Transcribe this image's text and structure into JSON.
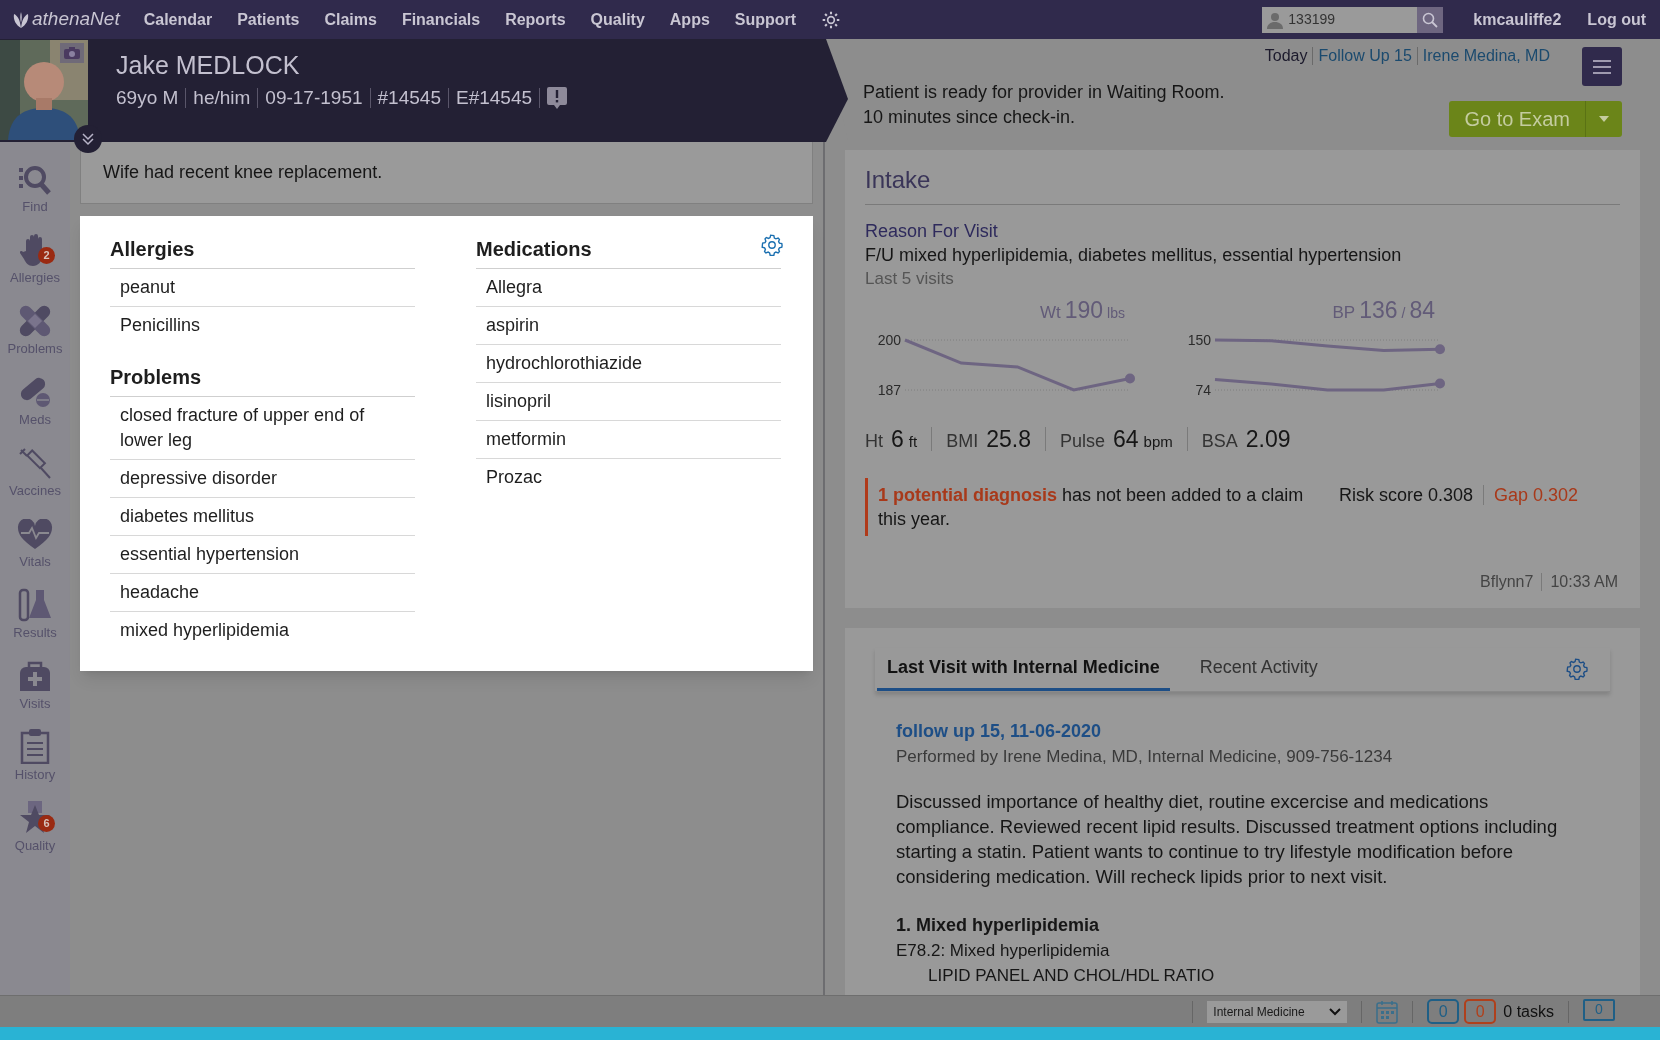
{
  "top_nav": {
    "logo": "athenaNet",
    "menu": [
      "Calendar",
      "Patients",
      "Claims",
      "Financials",
      "Reports",
      "Quality",
      "Apps",
      "Support"
    ],
    "search": {
      "value": "133199"
    },
    "user": "kmcauliffe2",
    "logout": "Log out"
  },
  "patient": {
    "photo": {
      "kind": "picture"
    },
    "name": "Jake MEDLOCK",
    "details": [
      "69yo M",
      "he/him",
      "09-17-1951",
      "#14545",
      "E#14545"
    ]
  },
  "visit_status": {
    "context": [
      {
        "text": "Today",
        "kind": "plain"
      },
      {
        "text": "Follow Up 15",
        "kind": "link"
      },
      {
        "text": "Irene Medina, MD",
        "kind": "link"
      }
    ],
    "message": [
      "Patient is ready for provider in Waiting Room.",
      "10 minutes since check-in."
    ],
    "primary_button": "Go to Exam"
  },
  "sidebar": {
    "items": [
      {
        "label": "Find"
      },
      {
        "label": "Allergies",
        "badge": "2"
      },
      {
        "label": "Problems"
      },
      {
        "label": "Meds"
      },
      {
        "label": "Vaccines"
      },
      {
        "label": "Vitals"
      },
      {
        "label": "Results"
      },
      {
        "label": "Visits"
      },
      {
        "label": "History"
      },
      {
        "label": "Quality",
        "badge": "6"
      }
    ]
  },
  "patient_note": "Wife had recent knee replacement.",
  "clinical_summary": {
    "sections": [
      {
        "title": "Allergies",
        "items": [
          "peanut",
          "Penicillins"
        ]
      },
      {
        "title": "Problems",
        "items": [
          "closed fracture of upper end of lower leg",
          "depressive disorder",
          "diabetes mellitus",
          "essential hypertension",
          "headache",
          "mixed hyperlipidemia"
        ]
      },
      {
        "title": "Medications",
        "items": [
          "Allegra",
          "aspirin",
          "hydrochlorothiazide",
          "lisinopril",
          "metformin",
          "Prozac"
        ]
      }
    ]
  },
  "intake": {
    "title": "Intake",
    "reason_label": "Reason For Visit",
    "reason": "F/U mixed hyperlipidemia, diabetes mellitus, essential hypertension",
    "history_label": "Last 5 visits",
    "charts": [
      {
        "reading": [
          {
            "text": "Wt",
            "kind": "label"
          },
          {
            "text": "190",
            "kind": "value"
          },
          {
            "text": "lbs",
            "kind": "unit"
          }
        ],
        "chart_data": {
          "type": "line",
          "ylim": [
            187,
            200
          ],
          "yticks": [
            187,
            200
          ],
          "series": [
            {
              "color": "#6e6582",
              "values": [
                200,
                194,
                193,
                187,
                190
              ]
            }
          ]
        }
      },
      {
        "reading": [
          {
            "text": "BP",
            "kind": "label"
          },
          {
            "text": "136",
            "kind": "value"
          },
          {
            "text": "/",
            "kind": "unit"
          },
          {
            "text": "84",
            "kind": "value"
          }
        ],
        "chart_data": {
          "type": "line",
          "ylim": [
            74,
            150
          ],
          "yticks": [
            74,
            150
          ],
          "series": [
            {
              "color": "#6e6582",
              "values": [
                150,
                149,
                141,
                134,
                136
              ]
            },
            {
              "color": "#6e6582",
              "values": [
                90,
                83,
                74,
                74,
                84
              ]
            }
          ]
        }
      }
    ],
    "vitals": [
      {
        "label": "Ht",
        "value": "6",
        "unit": "ft"
      },
      {
        "label": "BMI",
        "value": "25.8"
      },
      {
        "label": "Pulse",
        "value": "64",
        "unit": "bpm"
      },
      {
        "label": "BSA",
        "value": "2.09"
      }
    ],
    "alert": {
      "text": "**1 potential diagnosis** has not been added to a claim this year.",
      "risk_score": "Risk score 0.308",
      "gap": "Gap 0.302"
    },
    "author": "Bflynn7",
    "time": "10:33 AM"
  },
  "visit_panel": {
    "tabs": [
      {
        "label": "Last Visit with Internal Medicine",
        "selected": true
      },
      {
        "label": "Recent Activity",
        "selected": false
      }
    ],
    "visit_link": "follow up 15, 11-06-2020",
    "performed_by": "Performed by Irene Medina, MD, Internal Medicine, 909-756-1234",
    "note": "Discussed importance of healthy diet, routine excercise and medications compliance. Reviewed recent lipid results. Discussed treatment options including starting a statin. Patient wants to continue to try lifestyle modification before considering medication. Will recheck lipids prior to next visit.",
    "plan": {
      "heading": "1. Mixed hyperlipidemia",
      "diagnosis": "E78.2: Mixed hyperlipidemia",
      "order": "LIPID PANEL AND CHOL/HDL RATIO"
    }
  },
  "status_bar": {
    "department": "Internal Medicine",
    "counters": [
      {
        "value": "0",
        "color": "#1f5f86"
      },
      {
        "value": "0",
        "color": "#b0401c"
      }
    ],
    "tasks": "0 tasks",
    "messages": "0"
  }
}
